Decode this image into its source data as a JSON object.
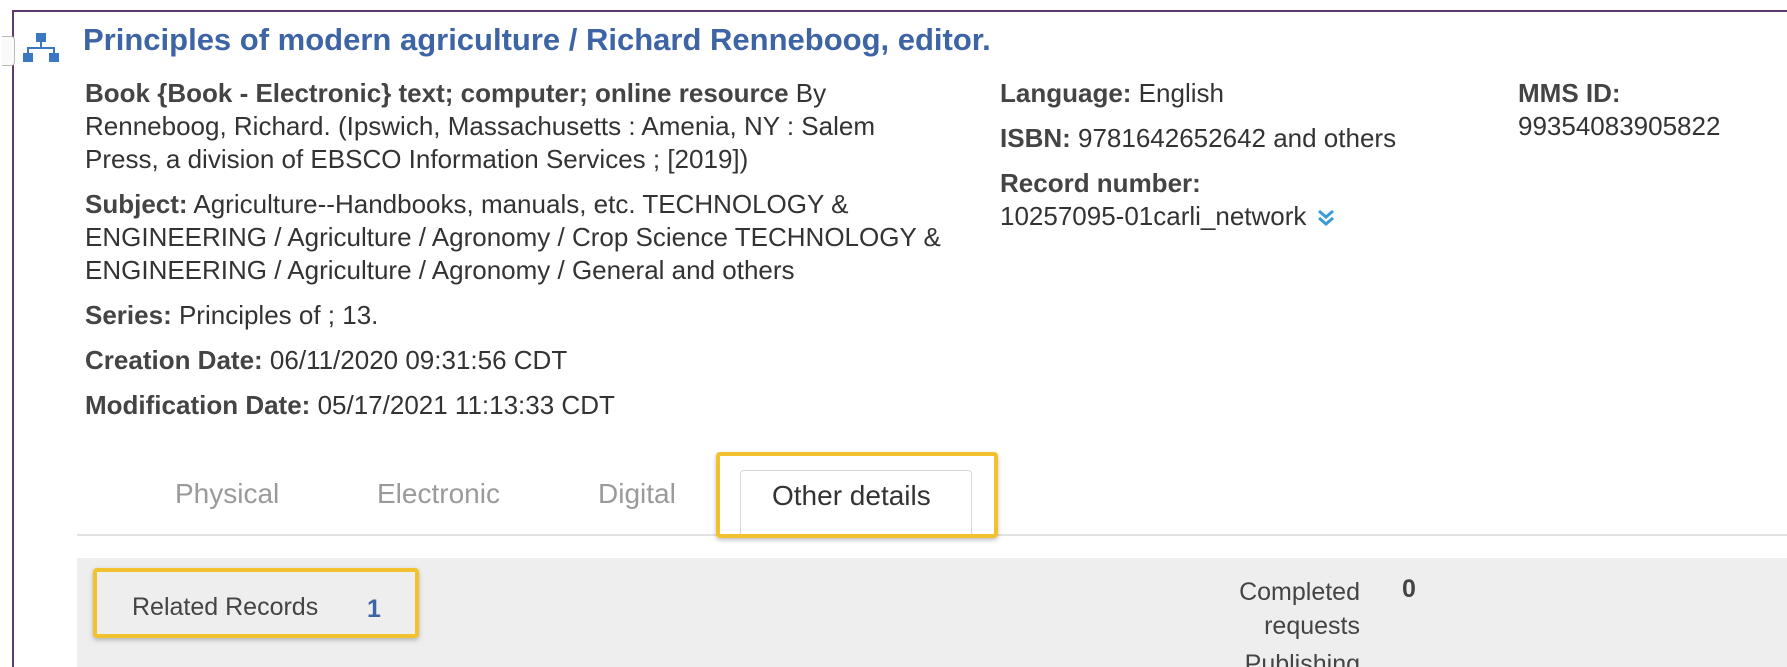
{
  "record": {
    "title": "Principles of modern agriculture / Richard Renneboog, editor.",
    "format_label": "Book {Book - Electronic} text; computer; online resource",
    "by_text": " By Renneboog, Richard. (Ipswich, Massachusetts : Amenia, NY : Salem Press, a division of EBSCO Information Services ; [2019])",
    "subject_label": "Subject:",
    "subject_value": " Agriculture--Handbooks, manuals, etc. TECHNOLOGY & ENGINEERING / Agriculture / Agronomy / Crop Science TECHNOLOGY & ENGINEERING / Agriculture / Agronomy / General and others",
    "series_label": "Series:",
    "series_value": " Principles of ; 13.",
    "creation_label": "Creation Date:",
    "creation_value": " 06/11/2020 09:31:56 CDT",
    "modification_label": "Modification Date:",
    "modification_value": " 05/17/2021 11:13:33 CDT",
    "language_label": "Language:",
    "language_value": " English",
    "isbn_label": "ISBN:",
    "isbn_value": " 9781642652642 and others",
    "record_number_label": "Record number:",
    "record_number_value": "10257095-01carli_network",
    "mms_id_label": "MMS ID:",
    "mms_id_value": "99354083905822"
  },
  "tabs": [
    {
      "label": "Physical",
      "active": false
    },
    {
      "label": "Electronic",
      "active": false
    },
    {
      "label": "Digital",
      "active": false
    },
    {
      "label": "Other details",
      "active": true
    }
  ],
  "details_panel": {
    "related_records_label": "Related Records",
    "related_records_count": "1",
    "completed_requests_label": "Completed requests",
    "completed_requests_value": "0",
    "publishing_label": "Publishing"
  },
  "colors": {
    "title_link": "#3d64a4",
    "highlight": "#f2c12e",
    "panel_bg": "#eeeeee",
    "frame": "#5e3a6e",
    "icon_blue": "#3a78c3"
  },
  "icons": {
    "hierarchy": "hierarchy-icon",
    "expand": "double-chevron-down-icon"
  }
}
